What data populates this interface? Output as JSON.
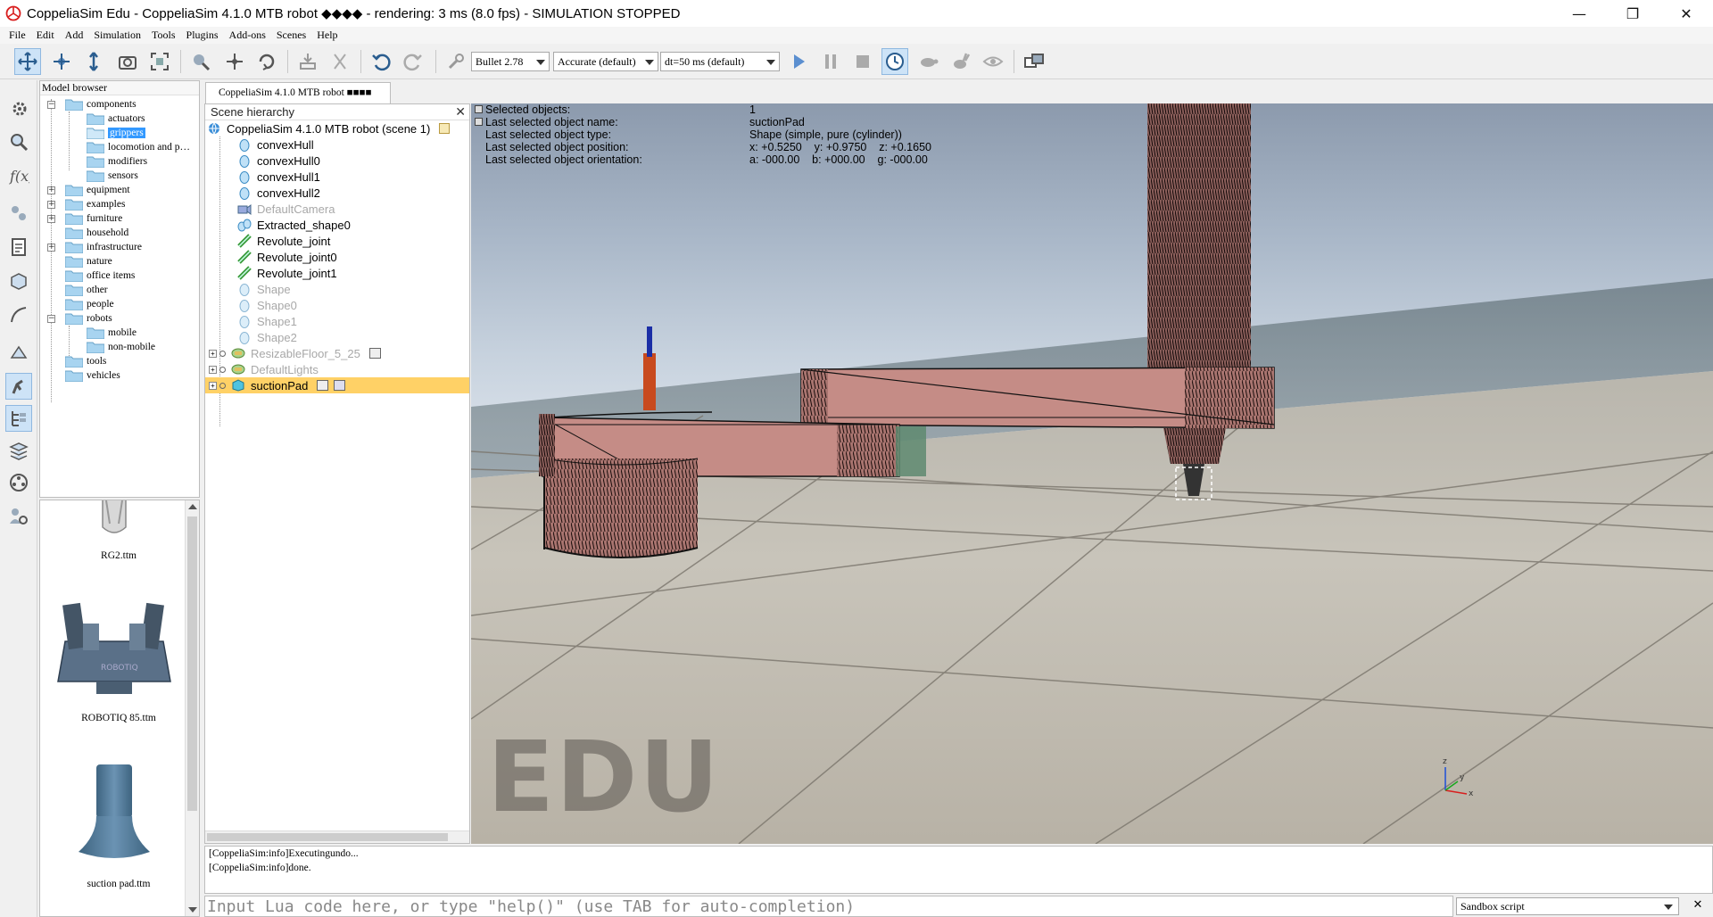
{
  "window": {
    "title": "CoppeliaSim Edu - CoppeliaSim 4.1.0 MTB robot ◆◆◆◆ - rendering: 3 ms (8.0 fps) - SIMULATION STOPPED",
    "minimize": "—",
    "maximize": "❐",
    "close": "✕"
  },
  "menubar": [
    "File",
    "Edit",
    "Add",
    "Simulation",
    "Tools",
    "Plugins",
    "Add-ons",
    "Scenes",
    "Help"
  ],
  "toolbar": {
    "physics_engine": "Bullet 2.78",
    "accuracy": "Accurate (default)",
    "timestep": "dt=50 ms (default)"
  },
  "model_browser": {
    "header": "Model browser",
    "items": [
      {
        "label": "components",
        "expander": "−"
      },
      {
        "label": "actuators"
      },
      {
        "label": "grippers"
      },
      {
        "label": "locomotion and p…"
      },
      {
        "label": "modifiers"
      },
      {
        "label": "sensors"
      },
      {
        "label": "equipment",
        "expander": "+"
      },
      {
        "label": "examples",
        "expander": "+"
      },
      {
        "label": "furniture",
        "expander": "+"
      },
      {
        "label": "household"
      },
      {
        "label": "infrastructure",
        "expander": "+"
      },
      {
        "label": "nature"
      },
      {
        "label": "office items"
      },
      {
        "label": "other"
      },
      {
        "label": "people"
      },
      {
        "label": "robots",
        "expander": "−"
      },
      {
        "label": "mobile"
      },
      {
        "label": "non-mobile"
      },
      {
        "label": "tools"
      },
      {
        "label": "vehicles"
      }
    ],
    "thumbnails": [
      "RG2.ttm",
      "ROBOTIQ 85.ttm",
      "suction pad.ttm"
    ]
  },
  "document_tab": "CoppeliaSim 4.1.0 MTB robot ■■■■",
  "scene_hierarchy": {
    "header": "Scene hierarchy",
    "close": "✕",
    "root": "CoppeliaSim 4.1.0 MTB robot (scene 1)",
    "items": [
      {
        "label": "convexHull",
        "type": "shape"
      },
      {
        "label": "convexHull0",
        "type": "shape"
      },
      {
        "label": "convexHull1",
        "type": "shape"
      },
      {
        "label": "convexHull2",
        "type": "shape"
      },
      {
        "label": "DefaultCamera",
        "type": "camera"
      },
      {
        "label": "Extracted_shape0",
        "type": "shape"
      },
      {
        "label": "Revolute_joint",
        "type": "joint"
      },
      {
        "label": "Revolute_joint0",
        "type": "joint"
      },
      {
        "label": "Revolute_joint1",
        "type": "joint"
      },
      {
        "label": "Shape",
        "type": "shape"
      },
      {
        "label": "Shape0",
        "type": "shape"
      },
      {
        "label": "Shape1",
        "type": "shape"
      },
      {
        "label": "Shape2",
        "type": "shape"
      },
      {
        "label": "ResizableFloor_5_25",
        "type": "model"
      },
      {
        "label": "DefaultLights",
        "type": "model"
      },
      {
        "label": "suctionPad",
        "type": "model"
      }
    ]
  },
  "selection_info": [
    {
      "label": "Selected objects:",
      "value": "1"
    },
    {
      "label": "Last selected object name:",
      "value": "suctionPad"
    },
    {
      "label": "Last selected object type:",
      "value": "Shape (simple, pure (cylinder))"
    },
    {
      "label": "Last selected object position:",
      "value": "x: +0.5250    y: +0.9750    z: +0.1650"
    },
    {
      "label": "Last selected object orientation:",
      "value": "a: -000.00    b: +000.00    g: -000.00"
    }
  ],
  "viewport": {
    "watermark": "EDU"
  },
  "console": {
    "lines": [
      "[CoppeliaSim:info]Executingundo...",
      "[CoppeliaSim:info]done."
    ],
    "input_placeholder": "Input Lua code here, or type \"help()\" (use TAB for auto-completion)",
    "script_selector": "Sandbox script",
    "close": "✕"
  }
}
